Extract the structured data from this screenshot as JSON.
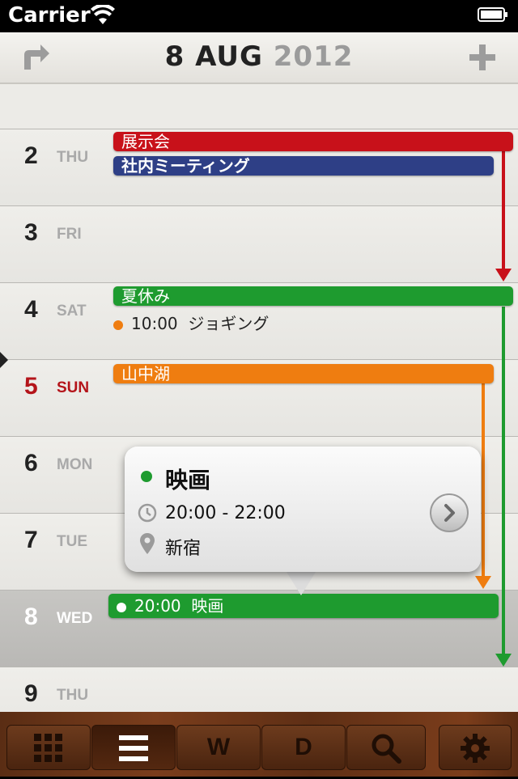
{
  "status_bar": {
    "carrier": "Carrier"
  },
  "header": {
    "day": "8",
    "month": "AUG",
    "year": "2012"
  },
  "days": [
    {
      "num": "2",
      "name": "THU"
    },
    {
      "num": "3",
      "name": "FRI"
    },
    {
      "num": "4",
      "name": "SAT"
    },
    {
      "num": "5",
      "name": "SUN"
    },
    {
      "num": "6",
      "name": "MON"
    },
    {
      "num": "7",
      "name": "TUE"
    },
    {
      "num": "8",
      "name": "WED"
    },
    {
      "num": "9",
      "name": "THU"
    }
  ],
  "events": {
    "exhibition": "展示会",
    "meeting": "社内ミーティング",
    "summer_vacation": "夏休み",
    "jogging_time": "10:00",
    "jogging": "ジョギング",
    "yamanaka": "山中湖",
    "movie_time": "20:00",
    "movie": "映画"
  },
  "popover": {
    "title": "映画",
    "time": "20:00 - 22:00",
    "place": "新宿"
  },
  "toolbar": {
    "week_label": "W",
    "day_label": "D"
  },
  "colors": {
    "red": "#c8111a",
    "blue": "#2e3f86",
    "green": "#1e9b2f",
    "orange": "#ef7d10",
    "sunday": "#b4141a"
  }
}
